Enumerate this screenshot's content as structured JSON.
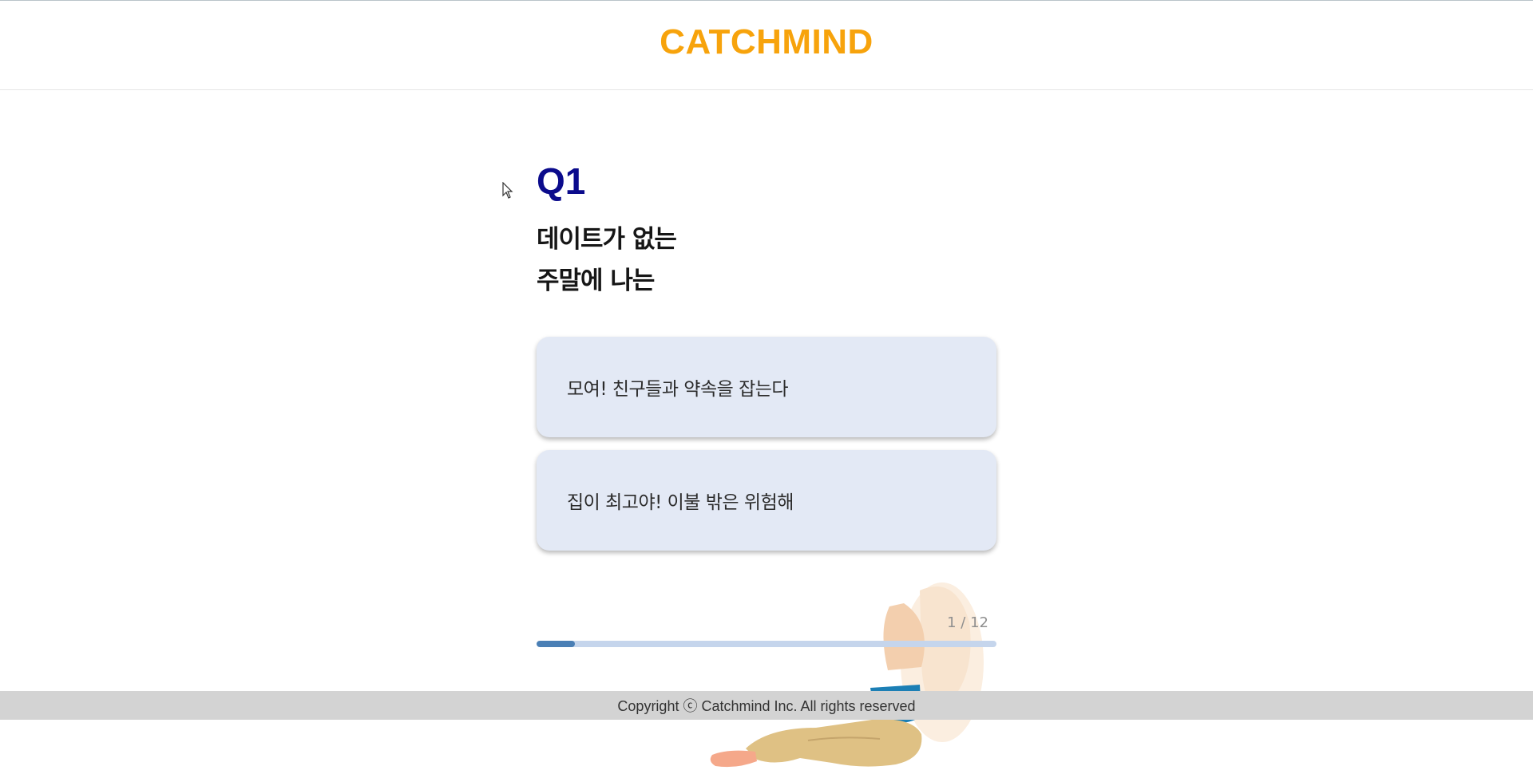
{
  "header": {
    "logo_text": "CATCHMIND"
  },
  "question": {
    "number": "Q1",
    "text_lines": [
      "데이트가 없는",
      "주말에 나는"
    ]
  },
  "answers": [
    {
      "label": "모여! 친구들과 약속을 잡는다"
    },
    {
      "label": "집이 최고야! 이불 밖은 위험해"
    }
  ],
  "progress": {
    "text": "1 / 12",
    "current": 1,
    "total": 12
  },
  "footer": {
    "copyright": "Copyright ⓒ Catchmind Inc. All rights reserved"
  },
  "colors": {
    "logo": "#f7a30c",
    "question_number": "#0b0b8c",
    "answer_bg": "#e3e9f5",
    "progress_track": "#c5d5ec",
    "progress_fill": "#4a7fb5",
    "footer_bg": "#d3d3d3"
  },
  "icons": {
    "cursor": "mouse-pointer-icon",
    "illustration": "person-lying-on-cushion-illustration"
  }
}
